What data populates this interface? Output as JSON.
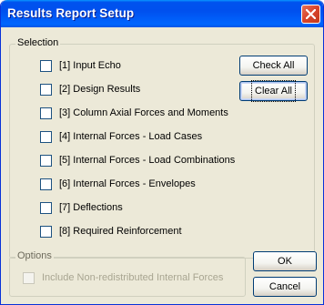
{
  "window": {
    "title": "Results Report Setup"
  },
  "selection": {
    "legend": "Selection",
    "items": [
      {
        "label": "[1] Input Echo",
        "checked": false
      },
      {
        "label": "[2] Design Results",
        "checked": false
      },
      {
        "label": "[3] Column Axial Forces and Moments",
        "checked": false
      },
      {
        "label": "[4] Internal Forces - Load Cases",
        "checked": false
      },
      {
        "label": "[5] Internal Forces - Load Combinations",
        "checked": false
      },
      {
        "label": "[6] Internal Forces - Envelopes",
        "checked": false
      },
      {
        "label": "[7] Deflections",
        "checked": false
      },
      {
        "label": "[8] Required Reinforcement",
        "checked": false
      }
    ],
    "check_all_label": "Check All",
    "clear_all_label": "Clear All"
  },
  "options": {
    "legend": "Options",
    "include_nonredistributed_label": "Include Non-redistributed Internal Forces",
    "include_nonredistributed_checked": false
  },
  "buttons": {
    "ok_label": "OK",
    "cancel_label": "Cancel"
  },
  "colors": {
    "titlebar": "#0054e3",
    "close": "#d8432a",
    "face": "#ece9d8"
  }
}
